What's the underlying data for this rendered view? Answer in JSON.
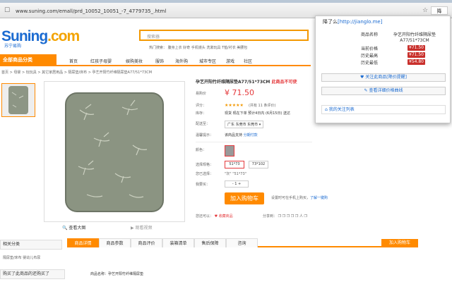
{
  "browser": {
    "url": "www.suning.com/emall/prd_10052_10051_-7_4779735_.html",
    "ext_icon_label": "降"
  },
  "site": {
    "logo_main": "Suning",
    "logo_com": ".com",
    "logo_sub": "苏宁易购",
    "search_placeholder": "搜索器",
    "hot_words": "热门搜索：  腹身上衣  好奇  手机镜头  洗漱玩具  T恤/衬衣  美腰包"
  },
  "nav": {
    "category_btn": "全部商品分类",
    "items": [
      "首页",
      "红孩子母婴",
      "娱购美妆",
      "服饰",
      "海外购",
      "城市专区",
      "游戏",
      "社区"
    ]
  },
  "breadcrumb": "首页 > 母婴 > 玩玩具 > 其它家居用品 > 隔尿垫/床布 > 孕艺开阳竹纤维隔尿垫A77/51*73CM",
  "gallery": {
    "zoom_label": "查看大图",
    "video_label": "观看视频"
  },
  "product": {
    "title": "孕艺开阳竹纤维隔尿垫A77/51*73CM",
    "title_tag": " 此商品不可使",
    "price_label": "易购价",
    "price": "¥ 71.50",
    "rating_label": "评分：",
    "stars": "★★★★★",
    "reviews": "(共有 11 条评价)",
    "stock_label": "库存：",
    "stock_text": "现货  现在下单 预计4日内 (6月15日) 送达",
    "ship_label": "配送至：",
    "ship_to": "广东 东莞市 东莞市 ▾",
    "tips_label": "温馨提示：",
    "tips_text": "该商品支持",
    "tips_link": " 分期付款",
    "color_label": "颜色：",
    "size_label": "选择规格：",
    "sizes": [
      "51*73",
      "73*102"
    ],
    "selected_label": "您已选择：",
    "selected": "\"灰\" \"51*73\"",
    "qty_label": "我要买：",
    "qty": "-    1    +",
    "add_cart": "加入购物车",
    "cart_side_text": "设置时可在手机上购买，",
    "cart_side_link": "了解一键购",
    "fav_label": "您还可以：",
    "fav_text": "♥ 收藏商品",
    "share_text": "分享到：  ❐ ❐ ❐ ❐ ❐ 人 ❐"
  },
  "tabs": {
    "items": [
      "商品详情",
      "商品参数",
      "商品评价",
      "装箱清单",
      "售后保障",
      "咨询"
    ],
    "cart_btn": "加入购物车",
    "detail_meta": "商品名称：孕艺开阳竹纤维隔尿垫"
  },
  "sidebar": {
    "related_title": "相关分类",
    "related_item": "隔尿垫/床布     婴幼儿布尿",
    "bought_title": "购买了此商品的还购买了"
  },
  "popup": {
    "title_prefix": "降了么",
    "title_link": "[http://jianglo.me]",
    "product_name": "孕艺开阳竹纤维隔尿垫A77/51*73CM",
    "rows": [
      {
        "label": "当前价格",
        "value": "¥71.50"
      },
      {
        "label": "历史最高",
        "value": "¥71.50"
      },
      {
        "label": "历史最低",
        "value": "¥54.80"
      }
    ],
    "name_label": "商品名称",
    "follow_btn": "♥ 关注此商品[降价提醒]",
    "chart_btn": "✎ 查看详细价格曲线",
    "my_follows": "我的关注列表"
  }
}
